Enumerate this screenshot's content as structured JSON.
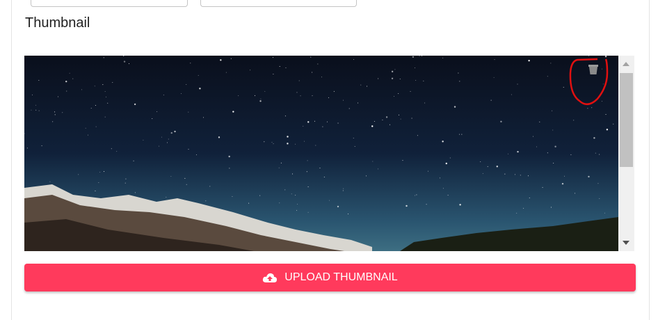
{
  "section": {
    "title": "Thumbnail"
  },
  "thumbnail": {
    "delete_icon": "trash-icon",
    "annotation_color": "#ff0000"
  },
  "upload_button": {
    "label": "UPLOAD THUMBNAIL",
    "icon": "cloud-upload-icon",
    "color": "#ff3a5c"
  }
}
